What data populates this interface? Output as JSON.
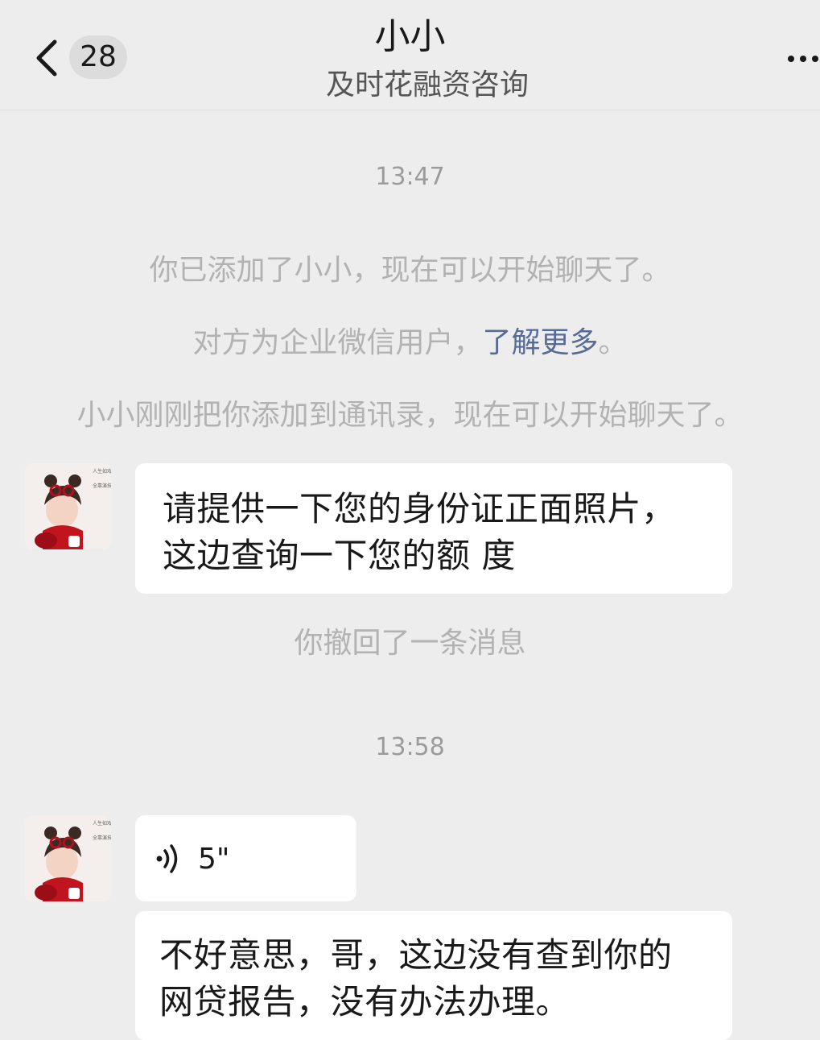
{
  "header": {
    "title": "小小",
    "subtitle": "及时花融资咨询",
    "unread_count": "28"
  },
  "messages": {
    "time_1": "13:47",
    "notice_added": "你已添加了小小，现在可以开始聊天了。",
    "notice_enterprise_prefix": "对方为企业微信用户，",
    "notice_enterprise_link": "了解更多",
    "notice_enterprise_suffix": "。",
    "notice_contact": "小小刚刚把你添加到通讯录，现在可以开始聊天了。",
    "msg_1_line_1": "请提供一下您的身份证正面照片，",
    "msg_1_line_2": "这边查询一下您的额 度",
    "notice_recalled": "你撤回了一条消息",
    "time_2": "13:58",
    "voice_duration": "5\"",
    "msg_3_line_1": "不好意思，哥，这边没有查到你的",
    "msg_3_line_2": "网贷报告，没有办法办理。"
  },
  "avatar_caption_1": "人生如戏",
  "avatar_caption_2": "全靠演技",
  "colors": {
    "background": "#ededed",
    "bubble": "#ffffff",
    "link": "#576b95",
    "notice": "#b2b2b2"
  }
}
